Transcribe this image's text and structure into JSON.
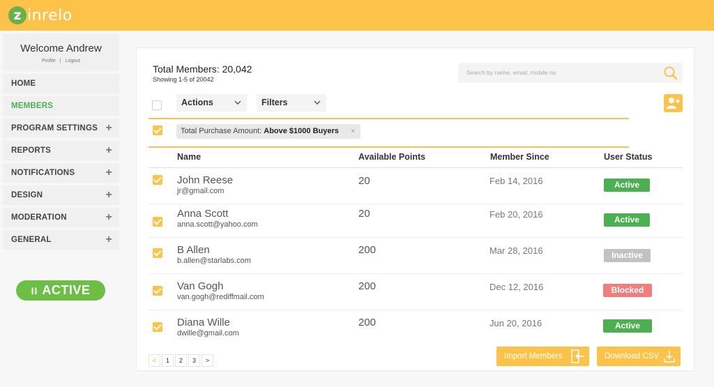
{
  "brand": {
    "logo_text": "zinrelo",
    "logo_letter": "z",
    "logo_rest": "inrelo",
    "color": "#fcc24a",
    "green": "#6cbe45"
  },
  "sidebar": {
    "welcome": "Welcome Andrew",
    "profile_link": "Profile",
    "separator": "|",
    "logout_link": "Logout",
    "items": [
      {
        "label": "HOME",
        "expandable": false,
        "active": false
      },
      {
        "label": "MEMBERS",
        "expandable": false,
        "active": true
      },
      {
        "label": "PROGRAM SETTINGS",
        "expandable": true
      },
      {
        "label": "REPORTS",
        "expandable": true
      },
      {
        "label": "NOTIFICATIONS",
        "expandable": true
      },
      {
        "label": "DESIGN",
        "expandable": true
      },
      {
        "label": "MODERATION",
        "expandable": true
      },
      {
        "label": "GENERAL",
        "expandable": true
      }
    ],
    "plus_glyph": "+",
    "program_status": {
      "pause_glyph": "II",
      "label": "ACTIVE"
    }
  },
  "members": {
    "total_label": "Total Members: 20,042",
    "showing_label": "Showing 1-5 of 20042",
    "search_placeholder": "Search by name, email, mobile no",
    "actions_label": "Actions",
    "filters_label": "Filters",
    "active_filter": {
      "key": "Total Purchase Amount:",
      "value": "Above $1000 Buyers",
      "remove": "×"
    },
    "columns": {
      "name": "Name",
      "points": "Available Points",
      "since": "Member Since",
      "status": "User Status"
    },
    "rows": [
      {
        "name": "John Reese",
        "email": "jr@gmail.com",
        "points": "20",
        "since": "Feb 14, 2016",
        "status": "Active",
        "status_color": "#4caf50"
      },
      {
        "name": "Anna Scott",
        "email": "anna.scott@yahoo.com",
        "points": "20",
        "since": "Feb 20, 2016",
        "status": "Active",
        "status_color": "#4caf50"
      },
      {
        "name": "B Allen",
        "email": "b.allen@starlabs.com",
        "points": "200",
        "since": "Mar 28, 2016",
        "status": "Inactive",
        "status_color": "#c2c2c2"
      },
      {
        "name": "Van Gogh",
        "email": "van.gogh@rediffmail.com",
        "points": "200",
        "since": "Dec 12, 2016",
        "status": "Blocked",
        "status_color": "#f07e7e"
      },
      {
        "name": "Diana Wille",
        "email": "dwille@gmail.com",
        "points": "200",
        "since": "Jun 20, 2016",
        "status": "Active",
        "status_color": "#4caf50"
      }
    ],
    "pagination": {
      "prev": "<",
      "pages": [
        "1",
        "2",
        "3"
      ],
      "next": ">"
    },
    "import_label": "Import Members",
    "download_label": "Download CSV"
  }
}
